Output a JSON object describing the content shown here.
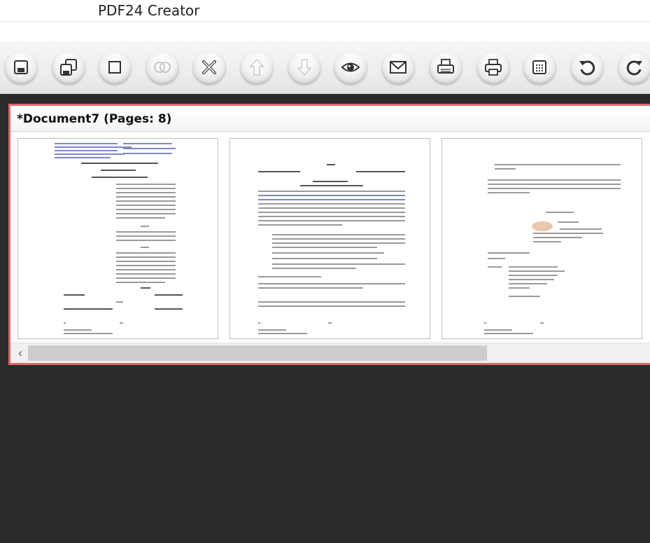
{
  "window": {
    "title": "PDF24 Creator"
  },
  "toolbar": {
    "buttons": [
      {
        "name": "save-button",
        "icon": "save-icon",
        "enabled": true
      },
      {
        "name": "save-as-button",
        "icon": "save-as-icon",
        "enabled": true
      },
      {
        "name": "select-button",
        "icon": "square-icon",
        "enabled": true
      },
      {
        "name": "merge-button",
        "icon": "merge-circles-icon",
        "enabled": false
      },
      {
        "name": "delete-button",
        "icon": "close-icon",
        "enabled": true
      },
      {
        "name": "move-up-button",
        "icon": "arrow-up-icon",
        "enabled": false
      },
      {
        "name": "move-down-button",
        "icon": "arrow-down-icon",
        "enabled": false
      },
      {
        "name": "preview-button",
        "icon": "eye-icon",
        "enabled": true
      },
      {
        "name": "email-button",
        "icon": "envelope-icon",
        "enabled": true
      },
      {
        "name": "fax-button",
        "icon": "fax-icon",
        "enabled": true
      },
      {
        "name": "print-button",
        "icon": "printer-icon",
        "enabled": true
      },
      {
        "name": "compress-button",
        "icon": "calculator-icon",
        "enabled": true
      },
      {
        "name": "rotate-left-button",
        "icon": "rotate-left-icon",
        "enabled": true
      },
      {
        "name": "rotate-right-button",
        "icon": "rotate-right-icon",
        "enabled": true
      }
    ]
  },
  "document": {
    "title": "*Document7 (Pages: 8)",
    "pages": [
      {
        "index": 1
      },
      {
        "index": 2
      },
      {
        "index": 3
      }
    ]
  },
  "colors": {
    "panel_border": "#d9696e",
    "background": "#2b2b2b"
  }
}
